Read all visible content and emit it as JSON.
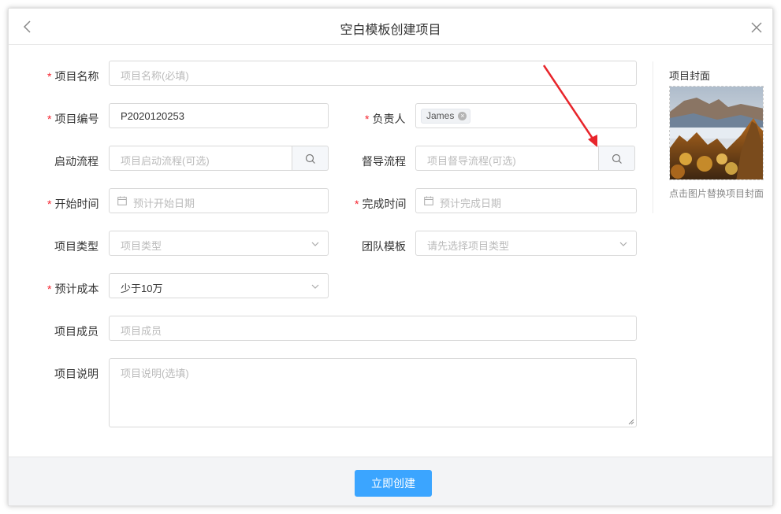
{
  "dialog": {
    "title": "空白模板创建项目",
    "back_icon": "chevron-left-icon",
    "close_icon": "close-icon"
  },
  "form": {
    "name": {
      "label": "项目名称",
      "required": true,
      "placeholder": "项目名称(必填)"
    },
    "code": {
      "label": "项目编号",
      "required": true,
      "value": "P2020120253"
    },
    "owner": {
      "label": "负责人",
      "required": true,
      "tag": "James"
    },
    "start_flow": {
      "label": "启动流程",
      "placeholder": "项目启动流程(可选)"
    },
    "supervise_flow": {
      "label": "督导流程",
      "placeholder": "项目督导流程(可选)"
    },
    "start_time": {
      "label": "开始时间",
      "required": true,
      "placeholder": "预计开始日期"
    },
    "finish_time": {
      "label": "完成时间",
      "required": true,
      "placeholder": "预计完成日期"
    },
    "type": {
      "label": "项目类型",
      "placeholder": "项目类型"
    },
    "team_template": {
      "label": "团队模板",
      "placeholder": "请先选择项目类型"
    },
    "cost": {
      "label": "预计成本",
      "required": true,
      "value": "少于10万"
    },
    "members": {
      "label": "项目成员",
      "placeholder": "项目成员"
    },
    "description": {
      "label": "项目说明",
      "placeholder": "项目说明(选填)"
    },
    "required_mark": "*"
  },
  "cover": {
    "title": "项目封面",
    "hint": "点击图片替换项目封面"
  },
  "footer": {
    "submit_label": "立即创建"
  },
  "colors": {
    "primary": "#3ba5ff",
    "required": "#f5222d",
    "annotation_arrow": "#e8252b"
  }
}
